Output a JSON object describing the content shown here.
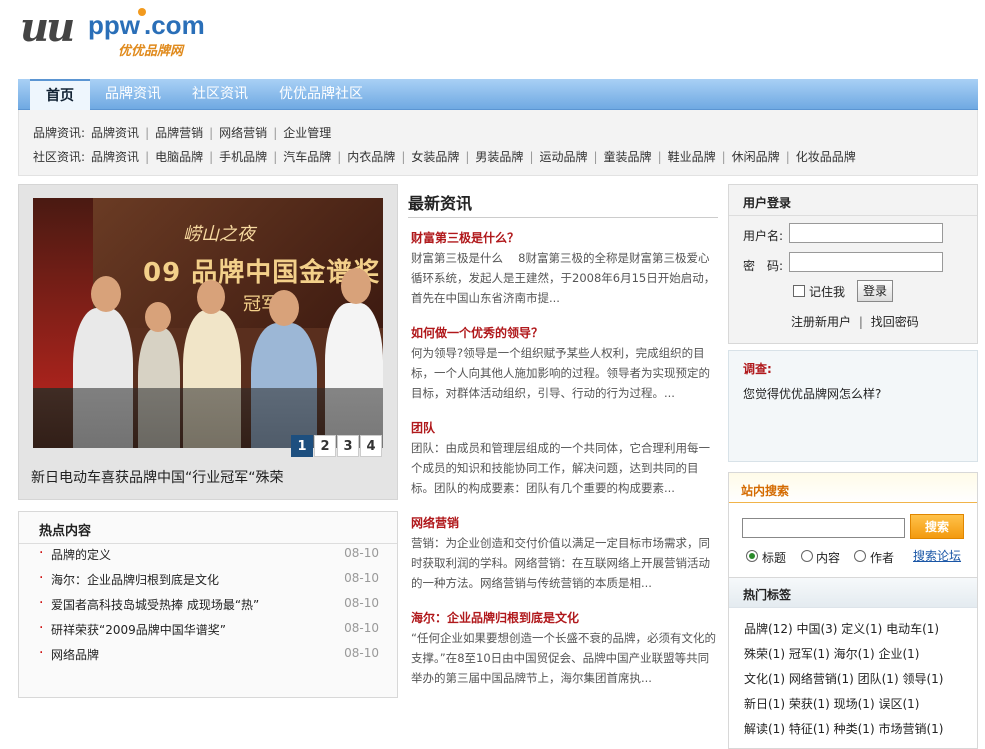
{
  "logo": {
    "uu": "uu",
    "ppw": "ppw",
    "com": ".com",
    "cn": "优优品牌网"
  },
  "nav": {
    "tabs": [
      "首页",
      "品牌资讯",
      "社区资讯",
      "优优品牌社区"
    ]
  },
  "subnav": {
    "row1_label": "品牌资讯:",
    "row1": [
      "品牌资讯",
      "品牌营销",
      "网络营销",
      "企业管理"
    ],
    "row2_label": "社区资讯:",
    "row2": [
      "品牌资讯",
      "电脑品牌",
      "手机品牌",
      "汽车品牌",
      "内衣品牌",
      "女装品牌",
      "男装品牌",
      "运动品牌",
      "童装品牌",
      "鞋业品牌",
      "休闲品牌",
      "化妆品品牌"
    ]
  },
  "slide": {
    "banner_line1": "崂山之夜",
    "banner_line2": "09 品牌中国金谱奖",
    "banner_line3": "冠军",
    "pages": [
      "1",
      "2",
      "3",
      "4"
    ],
    "caption": "新日电动车喜获品牌中国“行业冠军“殊荣"
  },
  "hot": {
    "title": "热点内容",
    "items": [
      {
        "text": "品牌的定义",
        "date": "08-10"
      },
      {
        "text": "海尔：企业品牌归根到底是文化",
        "date": "08-10"
      },
      {
        "text": "爱国者高科技岛城受热捧 成现场最“热”",
        "date": "08-10"
      },
      {
        "text": "研祥荣获“2009品牌中国华谱奖”",
        "date": "08-10"
      },
      {
        "text": "网络品牌",
        "date": "08-10"
      }
    ]
  },
  "news": {
    "heading": "最新资讯",
    "articles": [
      {
        "title": "财富第三极是什么？",
        "desc": "财富第三极是什么　 8财富第三极的全称是财富第三极爱心循环系统，发起人是王建然，于2008年6月15日开始启动，首先在中国山东省济南市提..."
      },
      {
        "title": "如何做一个优秀的领导？",
        "desc": "何为领导?领导是一个组织赋予某些人权利，完成组织的目标，一个人向其他人施加影响的过程。领导者为实现预定的目标，对群体活动组织，引导、行动的行为过程。..."
      },
      {
        "title": "团队",
        "desc": "团队：由成员和管理层组成的一个共同体，它合理利用每一个成员的知识和技能协同工作，解决问题，达到共同的目标。团队的构成要素：团队有几个重要的构成要素..."
      },
      {
        "title": "网络营销",
        "desc": "营销：为企业创造和交付价值以满足一定目标市场需求，同时获取利润的学科。网络营销：在互联网络上开展营销活动的一种方法。网络营销与传统营销的本质是相..."
      },
      {
        "title": "海尔：企业品牌归根到底是文化",
        "desc": "“任何企业如果要想创造一个长盛不衰的品牌，必须有文化的支撑。”在8至10日由中国贸促会、品牌中国产业联盟等共同举办的第三届中国品牌节上，海尔集团首席执..."
      }
    ]
  },
  "login": {
    "title": "用户登录",
    "username_label": "用户名:",
    "password_label": "密　码:",
    "remember": "记住我",
    "submit": "登录",
    "register": "注册新用户",
    "forgot": "找回密码",
    "sep": "|"
  },
  "survey": {
    "title": "调查:",
    "question": "您觉得优优品牌网怎么样?"
  },
  "search": {
    "title": "站内搜索",
    "button": "搜索",
    "opt_title": "标题",
    "opt_content": "内容",
    "opt_author": "作者",
    "forum": "搜索论坛"
  },
  "tags": {
    "title": "热门标签",
    "rows": [
      "品牌(12)  中国(3)  定义(1)  电动车(1)",
      "殊荣(1)  冠军(1)  海尔(1)  企业(1)",
      "文化(1)  网络营销(1)  团队(1)  领导(1)",
      "新日(1)  荣获(1)  现场(1)  误区(1)",
      "解读(1)  特征(1)  种类(1)  市场营销(1)"
    ]
  },
  "colors": {
    "nav": "#6fa9e2",
    "headline_red": "#b0181b",
    "search_orange": "#f39a0f"
  }
}
